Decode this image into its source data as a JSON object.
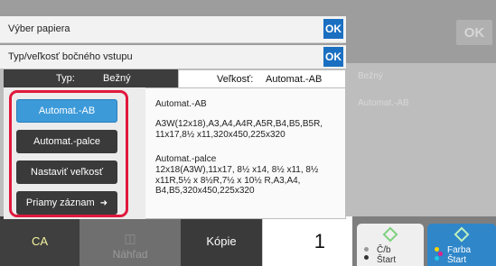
{
  "background": {
    "ok_label": "OK",
    "ghost_1": "Bežný",
    "ghost_2": "Automat.-AB"
  },
  "dialog_paper": {
    "title": "Výber papiera",
    "ok_label": "OK"
  },
  "dialog_bypass": {
    "title": "Typ/veľkosť bočného vstupu",
    "ok_label": "OK",
    "tabs": {
      "type_label": "Typ:",
      "type_value": "Bežný",
      "size_label": "Veľkosť:",
      "size_value": "Automat.-AB"
    },
    "options": {
      "auto_ab": "Automat.-AB",
      "auto_inch": "Automat.-palce",
      "set_size": "Nastaviť veľkosť",
      "direct_entry": "Priamy záznam"
    },
    "info": {
      "ab_title": "Automat.-AB",
      "ab_sizes": "A3W(12x18),A3,A4,A4R,A5R,B4,B5,B5R, 11x17,8½ x11,320x450,225x320",
      "inch_title": "Automat.-palce",
      "inch_sizes": "12x18(A3W),11x17, 8½ x14, 8½ x11, 8½ x11R,5½ x 8½R,7½ x 10½ R,A3,A4, B4,B5,320x450,225x320"
    }
  },
  "bottom_bar": {
    "ca_label": "CA",
    "preview_label": "Náhľad",
    "copies_label": "Kópie",
    "copies_value": "1",
    "bw_start_label_1": "Č/b",
    "bw_start_label_2": "Štart",
    "color_start_label_1": "Farba",
    "color_start_label_2": "Štart"
  },
  "colors": {
    "ok_blue": "#1a6fc1",
    "selected_option": "#3d9ad9",
    "highlight_red": "#e0183c",
    "color_start_blue": "#2f86c8"
  }
}
